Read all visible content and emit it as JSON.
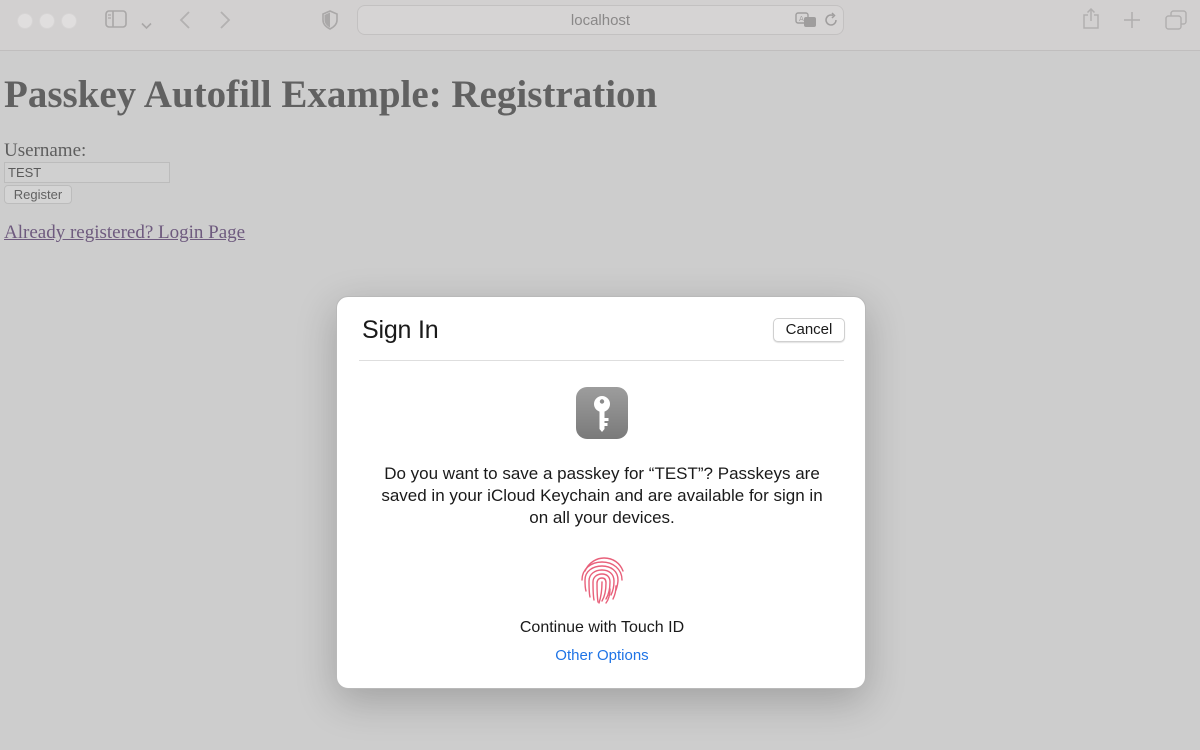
{
  "browser": {
    "address": "localhost",
    "icons": [
      "close-dot",
      "minimize-dot",
      "zoom-dot",
      "sidebar-icon",
      "chevron-down-icon",
      "back-icon",
      "forward-icon",
      "shield-icon",
      "translate-icon",
      "reload-icon",
      "share-icon",
      "new-tab-icon",
      "tabs-icon"
    ]
  },
  "page": {
    "title": "Passkey Autofill Example: Registration",
    "username_label": "Username:",
    "username_value": "TEST",
    "register_label": "Register",
    "login_link": "Already registered? Login Page"
  },
  "dialog": {
    "title": "Sign In",
    "cancel_label": "Cancel",
    "app_icon": "keychain-key-icon",
    "message": "Do you want to save a passkey for “TEST”? Passkeys are saved in your iCloud Keychain and are available for sign in on all your devices.",
    "touch_icon": "fingerprint-icon",
    "touch_label": "Continue with Touch ID",
    "other_options": "Other Options"
  },
  "colors": {
    "overlay": "#cdcdcd",
    "link_blue": "#1f74e6",
    "fingerprint": "#e8607a"
  }
}
